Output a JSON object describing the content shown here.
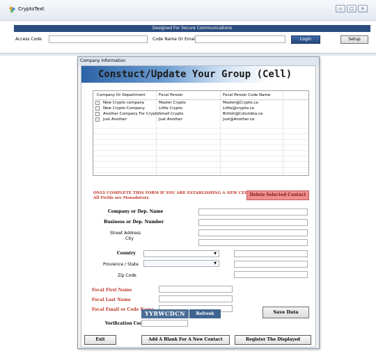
{
  "main_window": {
    "title": "CryptoText",
    "controls": {
      "minimize": "▭",
      "maximize": "□",
      "close": "✕"
    },
    "banner": "Designed For Secure Communications",
    "access_code_label": "Access Code",
    "access_code_value": "",
    "code_name_label": "Code Name Or Email",
    "code_name_value": "",
    "login_label": "Login",
    "setup_label": "Setup"
  },
  "dialog": {
    "title": "Company Information",
    "heading": "Constuct/Update Your Group (Cell)",
    "grid": {
      "columns": [
        "Company Or Department",
        "Focal Person",
        "Focal Person Code Name"
      ],
      "rows": [
        {
          "company": "New Crypto company",
          "focal": "Master Crypto",
          "code": "Master@Crypto.ca"
        },
        {
          "company": "New Crypto Company",
          "focal": "Little Crypto",
          "code": "Little@crypto.ca"
        },
        {
          "company": "Another Company For Crypto",
          "focal": "Small Crypto",
          "code": "British@Columbia.ca"
        },
        {
          "company": "Just Another",
          "focal": "Just Another",
          "code": "Just@Another.ca"
        }
      ]
    },
    "warning_line1": "ONLY COMPLETE THIS FORM IF YOU ARE ESTABLISHING A NEW CELL.",
    "warning_line2": "All Fields are Manadatory.",
    "delete_label": "Delete Selected Contact",
    "form": {
      "company_label": "Company or Dep. Name",
      "business_label": "Business or Dep. Number",
      "street_label": "Street Address",
      "city_label": "City",
      "country_label": "Country",
      "province_label": "Provience / State",
      "zip_label": "Zip Code",
      "first_name_label": "Focal First Name",
      "last_name_label": "Focal Last Name",
      "email_label": "Focal Email or Code Name"
    },
    "captcha_text": "YYRWCDCN",
    "refresh_label": "Refresh",
    "save_label": "Save Data",
    "verification_label": "Verification Code",
    "exit_label": "Exit",
    "add_blank_label": "Add A Blank For A New Contact",
    "register_label": "Register The Displayed"
  }
}
